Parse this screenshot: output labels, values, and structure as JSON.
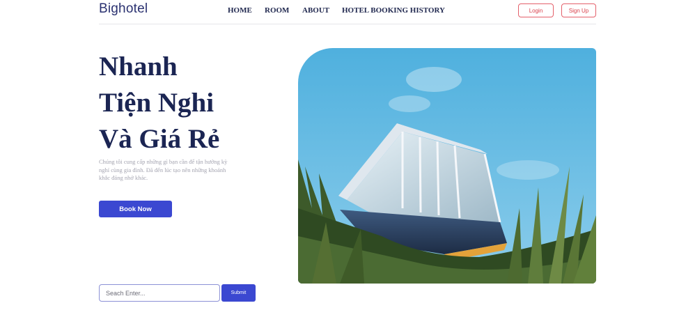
{
  "brand": {
    "logo": "Bighotel"
  },
  "nav": {
    "items": [
      {
        "label": "HOME"
      },
      {
        "label": "ROOM"
      },
      {
        "label": "ABOUT"
      },
      {
        "label": "HOTEL BOOKING HISTORY"
      }
    ]
  },
  "auth": {
    "login_label": "Login",
    "signup_label": "Sign Up"
  },
  "hero": {
    "title_lines": [
      "Nhanh",
      "Tiện Nghi",
      "Và Giá Rẻ"
    ],
    "description": "Chúng tôi cung cấp những gì bạn cần để tận hưởng kỳ nghỉ cùng gia đình. Đã đến lúc tạo nên những khoảnh khắc đáng nhớ khác.",
    "book_label": "Book Now"
  },
  "search": {
    "placeholder": "Seach Enter...",
    "value": "",
    "submit_label": "Submit"
  },
  "colors": {
    "primary": "#3b48d1",
    "accent_red": "#d9404b",
    "heading": "#1b2553",
    "sky": "#56b4e0"
  }
}
